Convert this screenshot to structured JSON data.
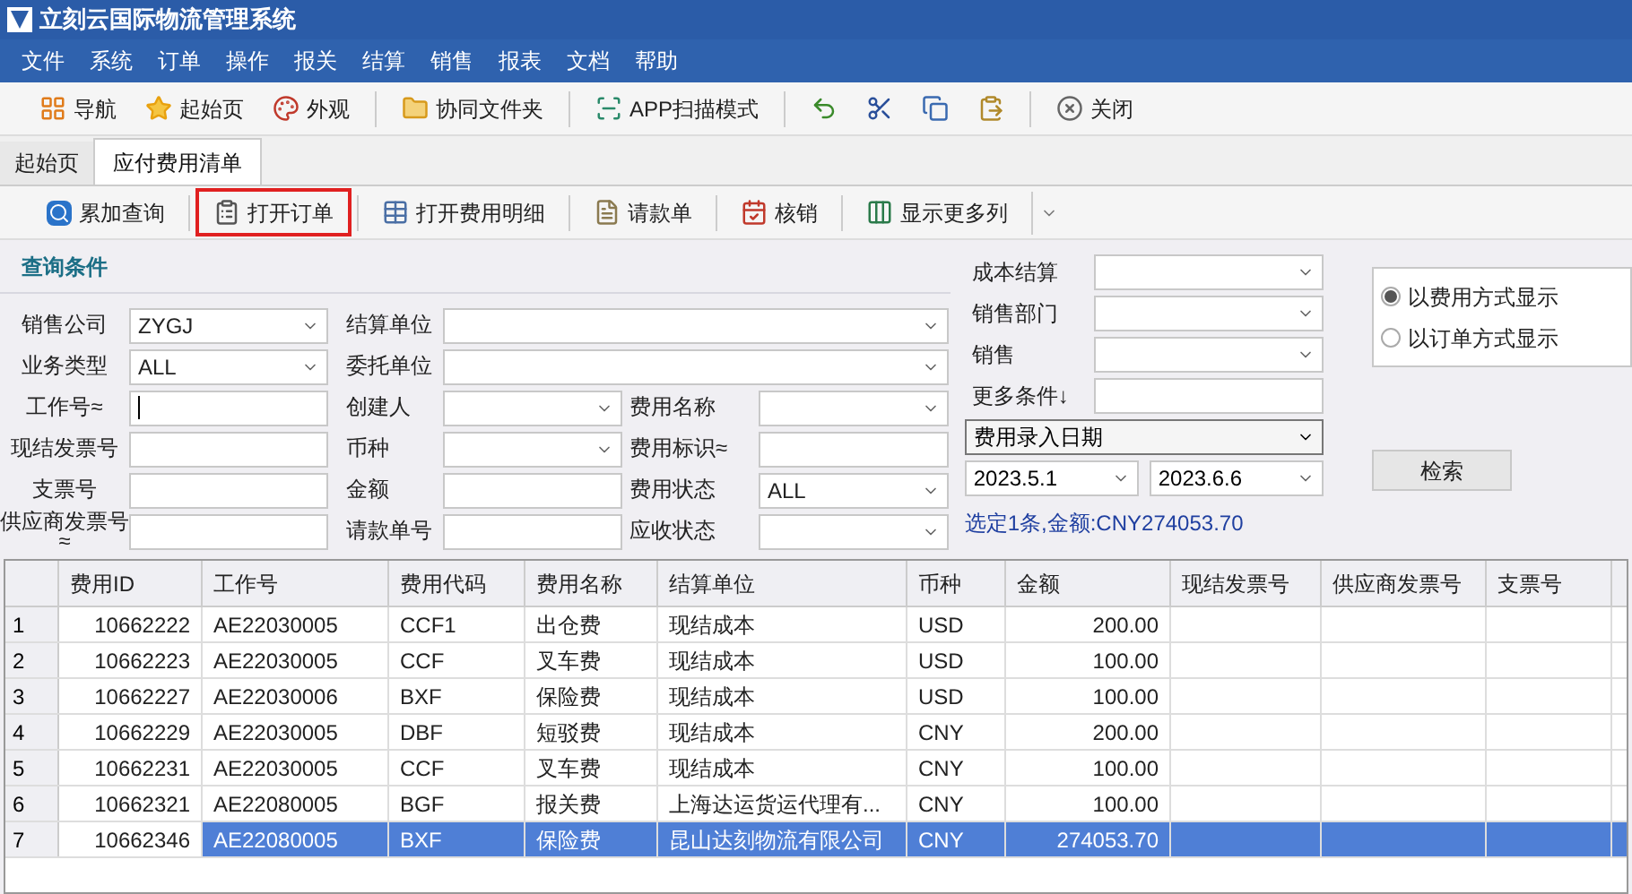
{
  "window": {
    "title": "立刻云国际物流管理系统"
  },
  "menu": [
    "文件",
    "系统",
    "订单",
    "操作",
    "报关",
    "结算",
    "销售",
    "报表",
    "文档",
    "帮助"
  ],
  "toolbar": [
    {
      "label": "导航",
      "kind": "nav"
    },
    {
      "label": "起始页",
      "kind": "star"
    },
    {
      "label": "外观",
      "kind": "theme"
    },
    {
      "label": "协同文件夹",
      "kind": "folder",
      "sep": true
    },
    {
      "label": "APP扫描模式",
      "kind": "scan",
      "sep": true
    },
    {
      "kind": "undo",
      "sep": true
    },
    {
      "kind": "cut"
    },
    {
      "kind": "copy"
    },
    {
      "kind": "paste"
    },
    {
      "label": "关闭",
      "kind": "close",
      "sep": true
    }
  ],
  "tabs": [
    {
      "label": "起始页",
      "selected": false
    },
    {
      "label": "应付费用清单",
      "selected": true
    }
  ],
  "subtoolbar": [
    {
      "label": "累加查询",
      "kind": "search",
      "highlighted": false
    },
    {
      "label": "打开订单",
      "kind": "clipboard",
      "highlighted": true
    },
    {
      "label": "打开费用明细",
      "kind": "grid",
      "highlighted": false
    },
    {
      "label": "请款单",
      "kind": "doc",
      "highlighted": false
    },
    {
      "label": "核销",
      "kind": "calendar",
      "highlighted": false
    },
    {
      "label": "显示更多列",
      "kind": "columns",
      "highlighted": false
    }
  ],
  "query": {
    "title": "查询条件",
    "rows": [
      [
        {
          "label": "销售公司",
          "kind": "combo",
          "value": "ZYGJ"
        },
        {
          "label": "结算单位",
          "kind": "combo",
          "wide": true
        }
      ],
      [
        {
          "label": "业务类型",
          "kind": "combo",
          "value": "ALL"
        },
        {
          "label": "委托单位",
          "kind": "combo",
          "wide": true
        }
      ],
      [
        {
          "label": "工作号≈",
          "kind": "text",
          "focused": true
        },
        {
          "label": "创建人",
          "kind": "combo"
        },
        {
          "label": "费用名称",
          "kind": "combo"
        }
      ],
      [
        {
          "label": "现结发票号",
          "kind": "text"
        },
        {
          "label": "币种",
          "kind": "combo"
        },
        {
          "label": "费用标识≈",
          "kind": "text"
        }
      ],
      [
        {
          "label": "支票号",
          "kind": "text"
        },
        {
          "label": "金额",
          "kind": "text"
        },
        {
          "label": "费用状态",
          "kind": "combo",
          "value": "ALL"
        }
      ],
      [
        {
          "label": "供应商发票号≈",
          "kind": "text"
        },
        {
          "label": "请款单号",
          "kind": "text"
        },
        {
          "label": "应收状态",
          "kind": "combo"
        }
      ]
    ],
    "right": [
      {
        "label": "成本结算",
        "kind": "combo"
      },
      {
        "label": "销售部门",
        "kind": "combo"
      },
      {
        "label": "销售",
        "kind": "combo"
      },
      {
        "label": "更多条件↓",
        "kind": "text"
      }
    ],
    "date_type": "费用录入日期",
    "date_from": "2023.5.1",
    "date_to": "2023.6.6",
    "summary": "选定1条,金额:CNY274053.70",
    "display_modes": [
      {
        "label": "以费用方式显示",
        "selected": true
      },
      {
        "label": "以订单方式显示",
        "selected": false
      }
    ],
    "search_button": "检索"
  },
  "table": {
    "columns": [
      "费用ID",
      "工作号",
      "费用代码",
      "费用名称",
      "结算单位",
      "币种",
      "金额",
      "现结发票号",
      "供应商发票号",
      "支票号"
    ],
    "rows": [
      {
        "num": "1",
        "cells": [
          "10662222",
          "AE22030005",
          "CCF1",
          "出仓费",
          "现结成本",
          "USD",
          "200.00",
          "",
          "",
          ""
        ],
        "selected": false
      },
      {
        "num": "2",
        "cells": [
          "10662223",
          "AE22030005",
          "CCF",
          "叉车费",
          "现结成本",
          "USD",
          "100.00",
          "",
          "",
          ""
        ],
        "selected": false
      },
      {
        "num": "3",
        "cells": [
          "10662227",
          "AE22030006",
          "BXF",
          "保险费",
          "现结成本",
          "USD",
          "100.00",
          "",
          "",
          ""
        ],
        "selected": false
      },
      {
        "num": "4",
        "cells": [
          "10662229",
          "AE22030005",
          "DBF",
          "短驳费",
          "现结成本",
          "CNY",
          "200.00",
          "",
          "",
          ""
        ],
        "selected": false
      },
      {
        "num": "5",
        "cells": [
          "10662231",
          "AE22030005",
          "CCF",
          "叉车费",
          "现结成本",
          "CNY",
          "100.00",
          "",
          "",
          ""
        ],
        "selected": false
      },
      {
        "num": "6",
        "cells": [
          "10662321",
          "AE22080005",
          "BGF",
          "报关费",
          "上海达运货运代理有...",
          "CNY",
          "100.00",
          "",
          "",
          ""
        ],
        "selected": false
      },
      {
        "num": "7",
        "cells": [
          "10662346",
          "AE22080005",
          "BXF",
          "保险费",
          "昆山达刻物流有限公司",
          "CNY",
          "274053.70",
          "",
          "",
          ""
        ],
        "selected": true
      }
    ]
  }
}
